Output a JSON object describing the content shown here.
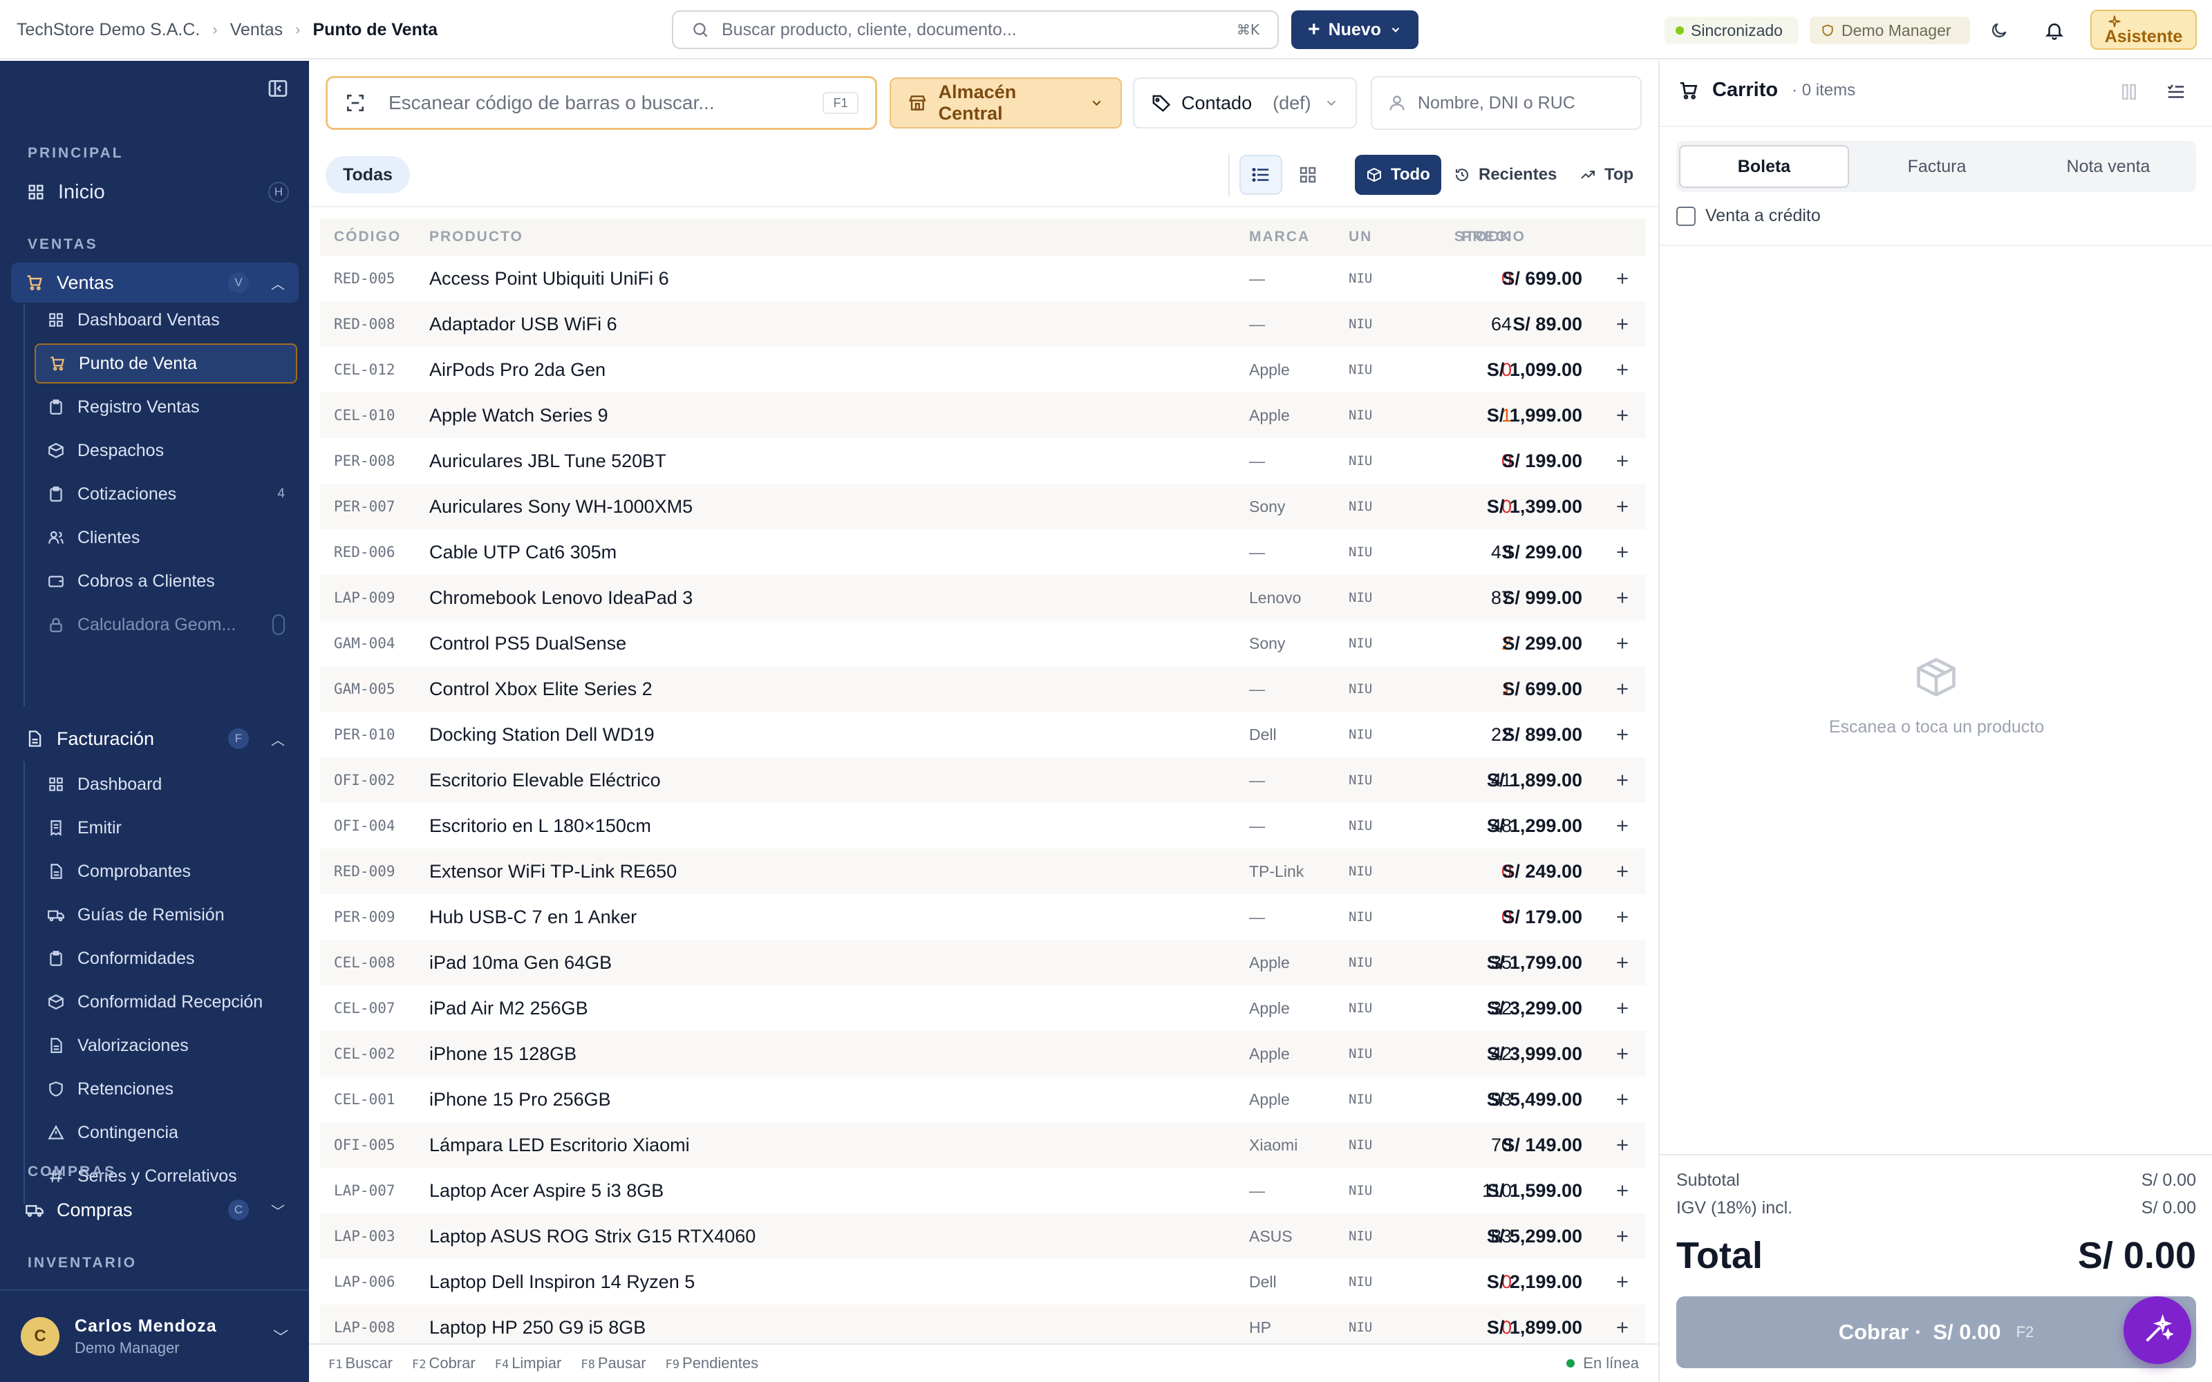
{
  "header": {
    "breadcrumb": [
      "TechStore Demo S.A.C.",
      "Ventas",
      "Punto de Venta"
    ],
    "search_placeholder": "Buscar producto, cliente, documento...",
    "search_shortcut": "⌘K",
    "new_label": "Nuevo",
    "sync_label": "Sincronizado",
    "role_label": "Demo Manager",
    "assistant_label": "Asistente"
  },
  "sidebar": {
    "sections": {
      "principal": "PRINCIPAL",
      "ventas": "VENTAS",
      "compras": "COMPRAS",
      "inventario": "INVENTARIO"
    },
    "inicio": {
      "label": "Inicio",
      "key": "H"
    },
    "ventas_group": {
      "label": "Ventas",
      "key": "V"
    },
    "ventas_items": [
      {
        "label": "Dashboard Ventas",
        "icon": "grid-icon"
      },
      {
        "label": "Punto de Venta",
        "icon": "cart-icon"
      },
      {
        "label": "Registro Ventas",
        "icon": "clipboard-icon"
      },
      {
        "label": "Despachos",
        "icon": "box-icon"
      },
      {
        "label": "Cotizaciones",
        "icon": "clipboard-icon",
        "badge": "4"
      },
      {
        "label": "Clientes",
        "icon": "users-icon"
      },
      {
        "label": "Cobros a Clientes",
        "icon": "wallet-icon"
      },
      {
        "label": "Calculadora Geom...",
        "icon": "lock-icon"
      }
    ],
    "facturacion_group": {
      "label": "Facturación",
      "key": "F"
    },
    "facturacion_items": [
      {
        "label": "Dashboard",
        "icon": "grid-icon"
      },
      {
        "label": "Emitir",
        "icon": "receipt-icon"
      },
      {
        "label": "Comprobantes",
        "icon": "file-icon"
      },
      {
        "label": "Guías de Remisión",
        "icon": "truck-icon"
      },
      {
        "label": "Conformidades",
        "icon": "clipboard-icon"
      },
      {
        "label": "Conformidad Recepción",
        "icon": "box-icon"
      },
      {
        "label": "Valorizaciones",
        "icon": "file-icon"
      },
      {
        "label": "Retenciones",
        "icon": "shield-icon"
      },
      {
        "label": "Contingencia",
        "icon": "warning-icon"
      },
      {
        "label": "Series y Correlativos",
        "icon": "hash-icon"
      }
    ],
    "compras_group": {
      "label": "Compras",
      "key": "C"
    },
    "user": {
      "initial": "C",
      "name": "Carlos Mendoza",
      "role": "Demo Manager"
    }
  },
  "pos": {
    "scan_placeholder": "Escanear código de barras o buscar...",
    "scan_shortcut": "F1",
    "warehouse": "Almacén Central",
    "pricelist": "Contado",
    "pricelist_tag": "(def)",
    "customer_placeholder": "Nombre, DNI o RUC",
    "category": "Todas",
    "filters": {
      "all": "Todo",
      "recent": "Recientes",
      "top": "Top"
    }
  },
  "table": {
    "headers": {
      "code": "CÓDIGO",
      "product": "PRODUCTO",
      "brand": "MARCA",
      "unit": "UN",
      "stock": "STOCK",
      "price": "PRECIO"
    },
    "rows": [
      {
        "code": "RED-005",
        "name": "Access Point Ubiquiti UniFi 6",
        "brand": "—",
        "unit": "NIU",
        "stock": "0",
        "price": "S/ 699.00"
      },
      {
        "code": "RED-008",
        "name": "Adaptador USB WiFi 6",
        "brand": "—",
        "unit": "NIU",
        "stock": "64",
        "price": "S/ 89.00"
      },
      {
        "code": "CEL-012",
        "name": "AirPods Pro 2da Gen",
        "brand": "Apple",
        "unit": "NIU",
        "stock": "0",
        "price": "S/ 1,099.00"
      },
      {
        "code": "CEL-010",
        "name": "Apple Watch Series 9",
        "brand": "Apple",
        "unit": "NIU",
        "stock": "1",
        "price": "S/ 1,999.00"
      },
      {
        "code": "PER-008",
        "name": "Auriculares JBL Tune 520BT",
        "brand": "—",
        "unit": "NIU",
        "stock": "0",
        "price": "S/ 199.00"
      },
      {
        "code": "PER-007",
        "name": "Auriculares Sony WH-1000XM5",
        "brand": "Sony",
        "unit": "NIU",
        "stock": "0",
        "price": "S/ 1,399.00"
      },
      {
        "code": "RED-006",
        "name": "Cable UTP Cat6 305m",
        "brand": "—",
        "unit": "NIU",
        "stock": "43",
        "price": "S/ 299.00"
      },
      {
        "code": "LAP-009",
        "name": "Chromebook Lenovo IdeaPad 3",
        "brand": "Lenovo",
        "unit": "NIU",
        "stock": "87",
        "price": "S/ 999.00"
      },
      {
        "code": "GAM-004",
        "name": "Control PS5 DualSense",
        "brand": "Sony",
        "unit": "NIU",
        "stock": "2",
        "price": "S/ 299.00"
      },
      {
        "code": "GAM-005",
        "name": "Control Xbox Elite Series 2",
        "brand": "—",
        "unit": "NIU",
        "stock": "1",
        "price": "S/ 699.00"
      },
      {
        "code": "PER-010",
        "name": "Docking Station Dell WD19",
        "brand": "Dell",
        "unit": "NIU",
        "stock": "22",
        "price": "S/ 899.00"
      },
      {
        "code": "OFI-002",
        "name": "Escritorio Elevable Eléctrico",
        "brand": "—",
        "unit": "NIU",
        "stock": "41",
        "price": "S/ 1,899.00"
      },
      {
        "code": "OFI-004",
        "name": "Escritorio en L 180×150cm",
        "brand": "—",
        "unit": "NIU",
        "stock": "48",
        "price": "S/ 1,299.00"
      },
      {
        "code": "RED-009",
        "name": "Extensor WiFi TP-Link RE650",
        "brand": "TP-Link",
        "unit": "NIU",
        "stock": "0",
        "price": "S/ 249.00"
      },
      {
        "code": "PER-009",
        "name": "Hub USB-C 7 en 1 Anker",
        "brand": "—",
        "unit": "NIU",
        "stock": "0",
        "price": "S/ 179.00"
      },
      {
        "code": "CEL-008",
        "name": "iPad 10ma Gen 64GB",
        "brand": "Apple",
        "unit": "NIU",
        "stock": "35",
        "price": "S/ 1,799.00"
      },
      {
        "code": "CEL-007",
        "name": "iPad Air M2 256GB",
        "brand": "Apple",
        "unit": "NIU",
        "stock": "32",
        "price": "S/ 3,299.00"
      },
      {
        "code": "CEL-002",
        "name": "iPhone 15 128GB",
        "brand": "Apple",
        "unit": "NIU",
        "stock": "42",
        "price": "S/ 3,999.00"
      },
      {
        "code": "CEL-001",
        "name": "iPhone 15 Pro 256GB",
        "brand": "Apple",
        "unit": "NIU",
        "stock": "93",
        "price": "S/ 5,499.00"
      },
      {
        "code": "OFI-005",
        "name": "Lámpara LED Escritorio Xiaomi",
        "brand": "Xiaomi",
        "unit": "NIU",
        "stock": "70",
        "price": "S/ 149.00"
      },
      {
        "code": "LAP-007",
        "name": "Laptop Acer Aspire 5 i3 8GB",
        "brand": "—",
        "unit": "NIU",
        "stock": "110",
        "price": "S/ 1,599.00"
      },
      {
        "code": "LAP-003",
        "name": "Laptop ASUS ROG Strix G15 RTX4060",
        "brand": "ASUS",
        "unit": "NIU",
        "stock": "83",
        "price": "S/ 5,299.00"
      },
      {
        "code": "LAP-006",
        "name": "Laptop Dell Inspiron 14 Ryzen 5",
        "brand": "Dell",
        "unit": "NIU",
        "stock": "0",
        "price": "S/ 2,199.00"
      },
      {
        "code": "LAP-008",
        "name": "Laptop HP 250 G9 i5 8GB",
        "brand": "HP",
        "unit": "NIU",
        "stock": "0",
        "price": "S/ 1,899.00"
      }
    ]
  },
  "statusbar": {
    "shortcuts": [
      {
        "key": "F1",
        "label": "Buscar"
      },
      {
        "key": "F2",
        "label": "Cobrar"
      },
      {
        "key": "F4",
        "label": "Limpiar"
      },
      {
        "key": "F8",
        "label": "Pausar"
      },
      {
        "key": "F9",
        "label": "Pendientes"
      }
    ],
    "online": "En línea"
  },
  "cart": {
    "title": "Carrito",
    "count": "· 0 items",
    "doc_types": [
      "Boleta",
      "Factura",
      "Nota venta"
    ],
    "credit_label": "Venta a crédito",
    "empty_message": "Escanea o toca un producto",
    "subtotal_label": "Subtotal",
    "subtotal_value": "S/ 0.00",
    "igv_label": "IGV (18%) incl.",
    "igv_value": "S/ 0.00",
    "total_label": "Total",
    "total_value": "S/ 0.00",
    "pay_label": "Cobrar ·",
    "pay_amount": "S/ 0.00",
    "pay_key": "F2"
  },
  "colors": {
    "sidebar_bg": "#1a2f5c",
    "primary": "#1e3a6e",
    "stock_out": "#dc2626",
    "stock_low": "#ea580c",
    "accent_amber": "#f1c27a",
    "fab": "#7e22ce"
  }
}
